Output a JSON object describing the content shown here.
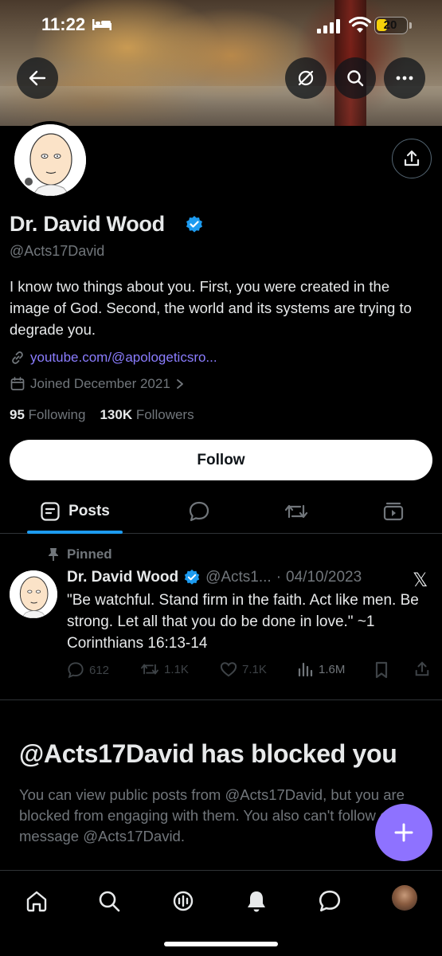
{
  "status_bar": {
    "time": "11:22",
    "battery": "20"
  },
  "profile": {
    "name": "Dr. David Wood",
    "handle": "@Acts17David",
    "bio": "I know two things about you. First, you were created in the image of God. Second, the world and its systems are trying to degrade you.",
    "link": "youtube.com/@apologeticsro...",
    "joined": "Joined December 2021",
    "following_count": "95",
    "following_label": "Following",
    "followers_count": "130K",
    "followers_label": "Followers",
    "follow_button": "Follow"
  },
  "tabs": [
    {
      "label": "Posts",
      "icon": "posts-icon",
      "active": true
    },
    {
      "label": "",
      "icon": "replies-icon"
    },
    {
      "label": "",
      "icon": "repost-icon"
    },
    {
      "label": "",
      "icon": "media-icon"
    }
  ],
  "pinned_post": {
    "pinned_label": "Pinned",
    "author_name": "Dr. David Wood",
    "author_handle": "@Acts1...",
    "separator": "·",
    "date": "04/10/2023",
    "text": "\"Be watchful. Stand firm in the faith. Act like men. Be strong. Let all that you do be done in love.\" ~1 Corinthians 16:13-14",
    "replies": "612",
    "reposts": "1.1K",
    "likes": "7.1K",
    "views": "1.6M"
  },
  "blocked": {
    "title": "@Acts17David has blocked you",
    "text": "You can view public posts from @Acts17David, but you are blocked from engaging with them. You also can't follow or message @Acts17David."
  },
  "colors": {
    "accent": "#1d9bf0",
    "fab": "#8e72ff",
    "link": "#8b7dff",
    "muted": "#71767b"
  },
  "bottom_nav": [
    "home-icon",
    "search-icon",
    "grok-icon",
    "notifications-icon",
    "messages-icon",
    "profile-avatar"
  ]
}
